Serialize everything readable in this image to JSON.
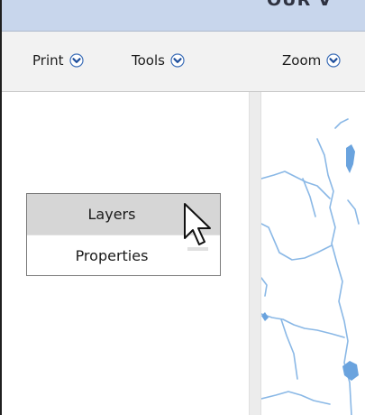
{
  "window": {
    "title_fragment": "OUR V"
  },
  "toolbar": {
    "items": [
      {
        "label": "Print",
        "icon": "chevron-down-circle-icon"
      },
      {
        "label": "Tools",
        "icon": "chevron-down-circle-icon"
      },
      {
        "label": "Zoom",
        "icon": "chevron-down-circle-icon"
      }
    ]
  },
  "context_menu": {
    "items": [
      {
        "label": "Layers",
        "state": "hovered"
      },
      {
        "label": "Properties",
        "state": "normal"
      }
    ]
  },
  "map": {
    "water_color": "#8ab8e6",
    "lake_color": "#6aa3de"
  },
  "colors": {
    "title_bar": "#c8d6ec",
    "toolbar_bg": "#f2f2f2",
    "menu_hover": "#d6d6d6",
    "icon_blue": "#3d6fb8"
  },
  "cursor": {
    "icon": "arrow-pointer-icon"
  }
}
